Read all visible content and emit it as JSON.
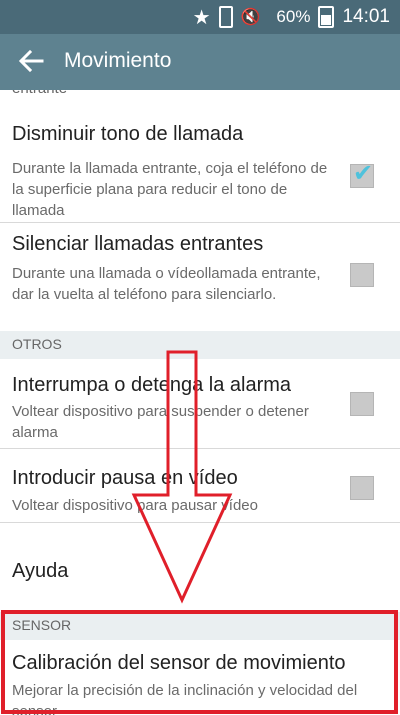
{
  "status_bar": {
    "battery": "60%",
    "time": "14:01",
    "icons": [
      "star-icon",
      "phone-icon",
      "mute-icon",
      "signal-icon",
      "battery-icon"
    ]
  },
  "app_bar": {
    "title": "Movimiento",
    "back_icon": "arrow-back-icon"
  },
  "list": {
    "cut_text": "entrante",
    "items": [
      {
        "title": "Disminuir tono de llamada",
        "desc": "Durante la llamada entrante, coja el teléfono de la superficie plana para reducir el tono de llamada",
        "checked": true
      },
      {
        "title": "Silenciar llamadas entrantes",
        "desc": "Durante una llamada o vídeollamada entrante, dar la vuelta al teléfono para silenciarlo.",
        "checked": false
      }
    ],
    "section_otros": "OTROS",
    "otros_items": [
      {
        "title": "Interrumpa o detenga la alarma",
        "desc": "Voltear dispositivo para suspender o detener alarma",
        "checked": false
      },
      {
        "title": "Introducir pausa en vídeo",
        "desc": "Voltear dispositivo para pausar vídeo",
        "checked": false
      }
    ],
    "help": "Ayuda",
    "section_sensor": "SENSOR",
    "sensor_item": {
      "title": "Calibración del sensor de movimiento",
      "desc": "Mejorar la precisión de la inclinación y velocidad del sensor"
    }
  },
  "colors": {
    "status_bar": "#4a6a78",
    "app_bar": "#5e8290",
    "accent_check": "#4fc2dc",
    "annotation_red": "#e01f2a"
  }
}
